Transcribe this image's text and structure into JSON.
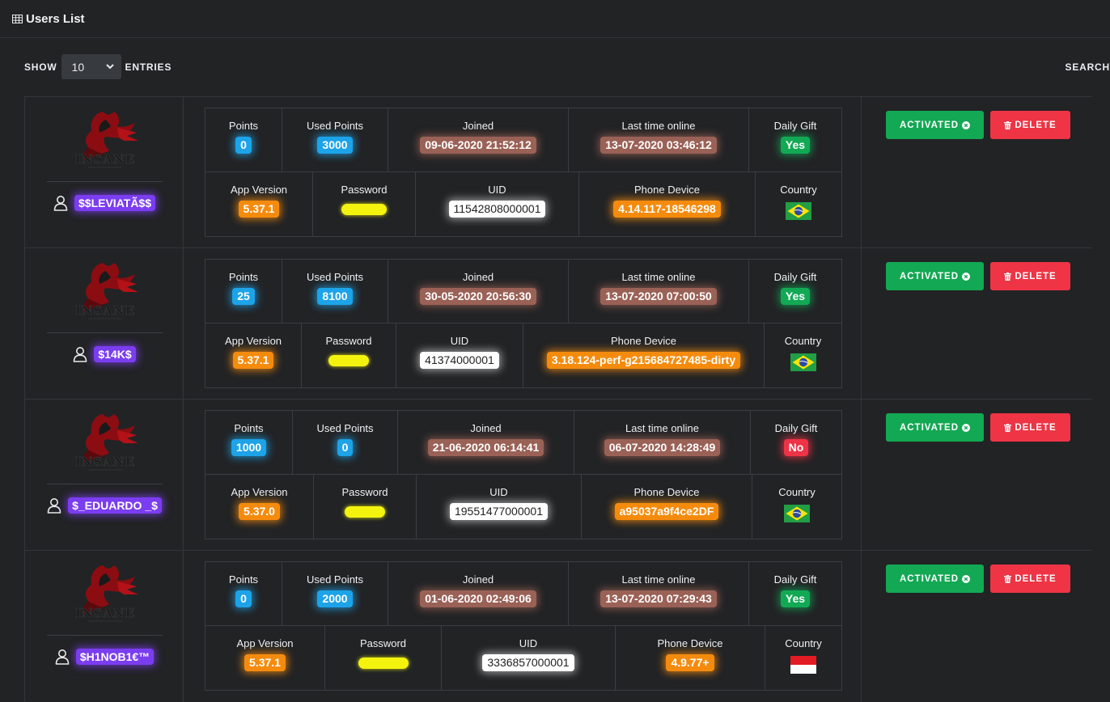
{
  "header": {
    "title": "Users List",
    "icon": "table-icon"
  },
  "controls": {
    "show_label": "SHOW",
    "entries_value": "10",
    "entries_label": "ENTRIES",
    "search_label": "SEARCH"
  },
  "colors": {
    "bg": "#222325",
    "purple": "#7b3df0",
    "blue": "#1da3e8",
    "brown": "#9a6156",
    "green": "#12a955",
    "red": "#ee3347",
    "orange": "#f58b0d"
  },
  "labels": {
    "points": "Points",
    "used_points": "Used Points",
    "joined": "Joined",
    "last_online": "Last time online",
    "daily_gift": "Daily Gift",
    "app_version": "App Version",
    "password": "Password",
    "uid": "UID",
    "phone_device": "Phone Device",
    "country": "Country",
    "activated": "ACTIVATED",
    "delete": "DELETE"
  },
  "users": [
    {
      "username": "$$LEVIATÃ$$",
      "points": "0",
      "used_points": "3000",
      "joined": "09-06-2020 21:52:12",
      "last_online": "13-07-2020 03:46:12",
      "daily_gift": "Yes",
      "daily_gift_status": "yes",
      "app_version": "5.37.1",
      "uid": "11542808000001",
      "phone_device": "4.14.117-18546298",
      "country": "brazil-flag"
    },
    {
      "username": "$14K$",
      "points": "25",
      "used_points": "8100",
      "joined": "30-05-2020 20:56:30",
      "last_online": "13-07-2020 07:00:50",
      "daily_gift": "Yes",
      "daily_gift_status": "yes",
      "app_version": "5.37.1",
      "uid": "41374000001",
      "phone_device": "3.18.124-perf-g215684727485-dirty",
      "country": "brazil-flag"
    },
    {
      "username": "$_EDUARDO _$",
      "points": "1000",
      "used_points": "0",
      "joined": "21-06-2020 06:14:41",
      "last_online": "06-07-2020 14:28:49",
      "daily_gift": "No",
      "daily_gift_status": "no",
      "app_version": "5.37.0",
      "uid": "19551477000001",
      "phone_device": "a95037a9f4ce2DF",
      "country": "brazil-flag"
    },
    {
      "username": "$H1NOB1€™",
      "points": "0",
      "used_points": "2000",
      "joined": "01-06-2020 02:49:06",
      "last_online": "13-07-2020 07:29:43",
      "daily_gift": "Yes",
      "daily_gift_status": "yes",
      "app_version": "5.37.1",
      "uid": "3336857000001",
      "phone_device": "4.9.77+",
      "country": "indonesia-flag"
    }
  ]
}
